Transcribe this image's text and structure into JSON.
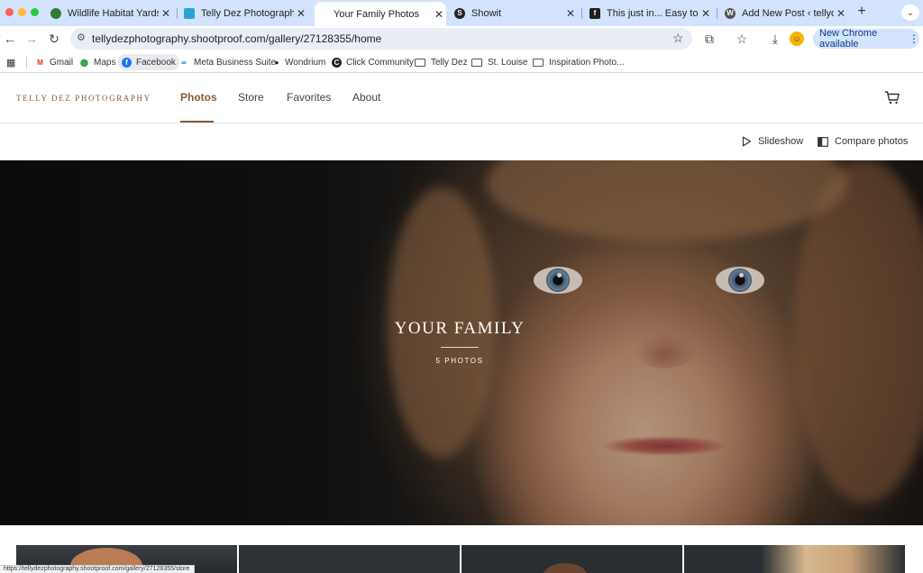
{
  "browser": {
    "tabs": [
      {
        "title": "Wildlife Habitat Yards | Wa",
        "favicon": "wildlife-favicon",
        "color": "#2e7d32"
      },
      {
        "title": "Telly Dez Photography | Sh",
        "favicon": "shootproof-favicon",
        "color": "#29a3d6"
      },
      {
        "title": "Your Family Photos",
        "favicon": "",
        "color": "#ffffff",
        "active": true
      },
      {
        "title": "Showit",
        "favicon": "showit-favicon",
        "color": "#222222"
      },
      {
        "title": "This just in... Easy to Orde",
        "favicon": "facebook-favicon",
        "color": "#1877f2"
      },
      {
        "title": "Add New Post ‹ tellydezph",
        "favicon": "wordpress-favicon",
        "color": "#555555"
      }
    ],
    "address": "tellydezphotography.shootproof.com/gallery/27128355/home",
    "update_label": "New Chrome available",
    "bookmarks": [
      {
        "label": "Gmail",
        "icon": "gmail-icon"
      },
      {
        "label": "Maps",
        "icon": "maps-icon"
      },
      {
        "label": "Facebook",
        "icon": "facebook-icon"
      },
      {
        "label": "Meta Business Suite",
        "icon": "meta-icon"
      },
      {
        "label": "Wondrium",
        "icon": "wondrium-icon"
      },
      {
        "label": "Click Community",
        "icon": "click-community-icon"
      },
      {
        "label": "Telly Dez",
        "icon": "folder-icon"
      },
      {
        "label": "St. Louise",
        "icon": "folder-icon"
      },
      {
        "label": "Inspiration Photo...",
        "icon": "folder-icon"
      }
    ],
    "status_url": "https://tellydezphotography.shootproof.com/gallery/27128355/store"
  },
  "site": {
    "brand": "TELLY DEZ PHOTOGRAPHY",
    "nav": [
      "Photos",
      "Store",
      "Favorites",
      "About"
    ],
    "active_nav": "Photos",
    "actions": {
      "slideshow": "Slideshow",
      "compare": "Compare photos"
    }
  },
  "hero": {
    "title": "YOUR FAMILY",
    "count": "5 PHOTOS"
  },
  "colors": {
    "accent": "#8a5a34",
    "tab_strip": "#d3e3fd"
  }
}
